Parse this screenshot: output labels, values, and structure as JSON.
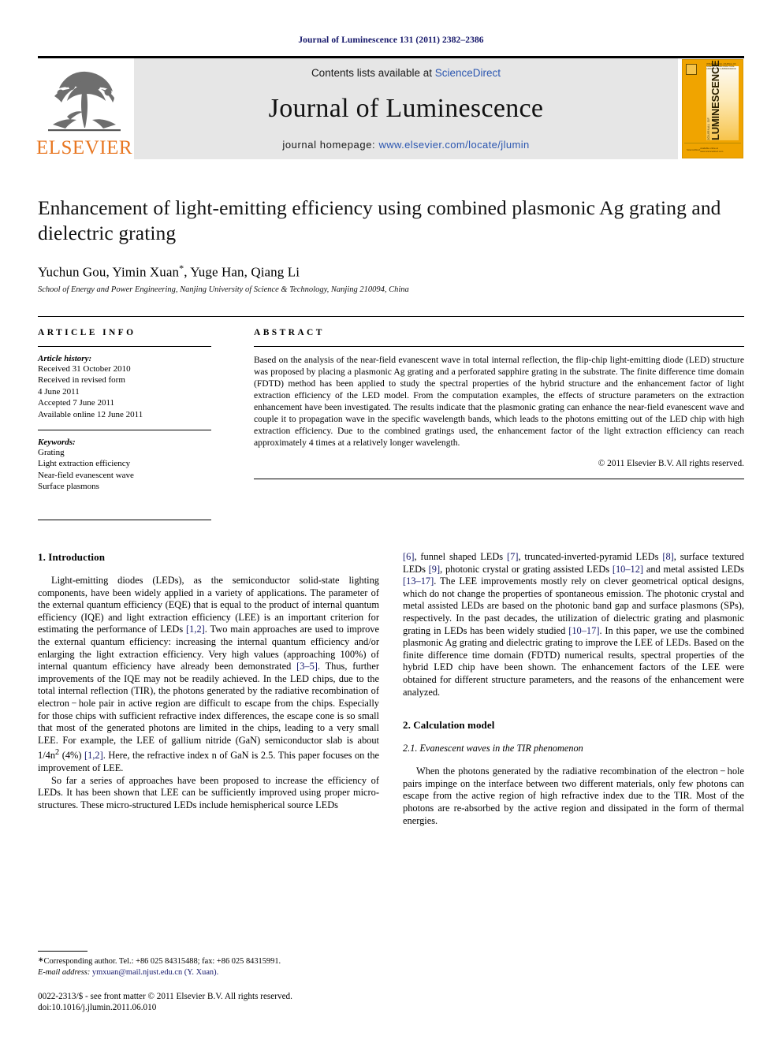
{
  "running_head": "Journal of Luminescence 131 (2011) 2382–2386",
  "masthead": {
    "publisher_wordmark": "ELSEVIER",
    "contents_prefix": "Contents lists available at ",
    "contents_link": "ScienceDirect",
    "journal_title": "Journal of Luminescence",
    "homepage_prefix": "journal homepage: ",
    "homepage_url": "www.elsevier.com/locate/jlumin",
    "cover": {
      "masthead_small": "INTERNATIONAL JOURNAL OF SCIENTIFIC AND PRACTICAL ASPECTS OF LUMINESCENCE",
      "journal_of": "JOURNAL OF",
      "title": "LUMINESCENCE",
      "footer_left": "ScienceDirect",
      "footer_right": "Available online at www.sciencedirect.com"
    },
    "link_color": "#2b56b0",
    "brand_color": "#e87722"
  },
  "article": {
    "title": "Enhancement of light-emitting efficiency using combined plasmonic Ag grating and dielectric grating",
    "authors": "Yuchun Gou, Yimin Xuan",
    "authors_tail": ", Yuge Han, Qiang Li",
    "corresponding_marker": "*",
    "affiliation": "School of Energy and Power Engineering, Nanjing University of Science & Technology, Nanjing 210094, China"
  },
  "article_info": {
    "label": "ARTICLE INFO",
    "history_head": "Article history:",
    "history": [
      "Received 31 October 2010",
      "Received in revised form",
      "4 June 2011",
      "Accepted 7 June 2011",
      "Available online 12 June 2011"
    ],
    "keywords_head": "Keywords:",
    "keywords": [
      "Grating",
      "Light extraction efficiency",
      "Near-field evanescent wave",
      "Surface plasmons"
    ]
  },
  "abstract": {
    "label": "ABSTRACT",
    "text": "Based on the analysis of the near-field evanescent wave in total internal reflection, the flip-chip light-emitting diode (LED) structure was proposed by placing a plasmonic Ag grating and a perforated sapphire grating in the substrate. The finite difference time domain (FDTD) method has been applied to study the spectral properties of the hybrid structure and the enhancement factor of light extraction efficiency of the LED model. From the computation examples, the effects of structure parameters on the extraction enhancement have been investigated. The results indicate that the plasmonic grating can enhance the near-field evanescent wave and couple it to propagation wave in the specific wavelength bands, which leads to the photons emitting out of the LED chip with high extraction efficiency. Due to the combined gratings used, the enhancement factor of the light extraction efficiency can reach approximately 4 times at a relatively longer wavelength.",
    "copyright": "© 2011 Elsevier B.V. All rights reserved."
  },
  "sections": {
    "intro_title": "1.  Introduction",
    "intro_p1_a": "Light-emitting diodes (LEDs), as the semiconductor solid-state lighting components, have been widely applied in a variety of applications. The parameter of the external quantum efficiency (EQE) that is equal to the product of internal quantum efficiency (IQE) and light extraction efficiency (LEE) is an important criterion for estimating the performance of LEDs ",
    "intro_ref_12a": "[1,2]",
    "intro_p1_b": ". Two main approaches are used to improve the external quantum efficiency: increasing the internal quantum efficiency and/or enlarging the light extraction efficiency. Very high values (approaching 100%) of internal quantum efficiency have already been demonstrated ",
    "intro_ref_35": "[3–5]",
    "intro_p1_c": ". Thus, further improvements of the IQE may not be readily achieved. In the LED chips, due to the total internal reflection (TIR), the photons generated by the radiative recombination of electron − hole pair in active region are difficult to escape from the chips. Especially for those chips with sufficient refractive index differences, the escape cone is so small that most of the generated photons are limited in the chips, leading to a very small LEE. For example, the LEE of gallium nitride (GaN) semiconductor slab is about 1/4n",
    "intro_p1_sup": "2",
    "intro_p1_d": " (4%) ",
    "intro_ref_12b": "[1,2]",
    "intro_p1_e": ". Here, the refractive index n of GaN is 2.5. This paper focuses on the improvement of LEE.",
    "intro_p2_a": "So far a series of approaches have been proposed to increase the efficiency of LEDs. It has been shown that LEE can be sufficiently improved using proper micro-structures. These micro-structured LEDs include hemispherical source LEDs ",
    "intro_ref_6": "[6]",
    "intro_p2_b": ", funnel shaped LEDs ",
    "intro_ref_7": "[7]",
    "intro_p2_c": ", truncated-inverted-pyramid LEDs ",
    "intro_ref_8": "[8]",
    "intro_p2_d": ", surface textured LEDs ",
    "intro_ref_9": "[9]",
    "intro_p2_e": ", photonic crystal or grating assisted LEDs ",
    "intro_ref_1012": "[10–12]",
    "intro_p2_f": " and metal assisted LEDs ",
    "intro_ref_1317": "[13–17]",
    "intro_p2_g": ". The LEE improvements mostly rely on clever geometrical optical designs, which do not change the properties of spontaneous emission. The photonic crystal and metal assisted LEDs are based on the photonic band gap and surface plasmons (SPs), respectively. In the past decades, the utilization of dielectric grating and plasmonic grating in LEDs has been widely studied ",
    "intro_ref_1017": "[10–17]",
    "intro_p2_h": ". In this paper, we use the combined plasmonic Ag grating and dielectric grating to improve the LEE of LEDs. Based on the finite difference time domain (FDTD) numerical results, spectral properties of the hybrid LED chip have been shown. The enhancement factors of the LEE were obtained for different structure parameters, and the reasons of the enhancement were analyzed.",
    "calc_title": "2.  Calculation model",
    "calc_subtitle": "2.1.  Evanescent waves in the TIR phenomenon",
    "calc_p1": "When the photons generated by the radiative recombination of the electron − hole pairs impinge on the interface between two different materials, only few photons can escape from the active region of high refractive index due to the TIR. Most of the photons are re-absorbed by the active region and dissipated in the form of thermal energies."
  },
  "footnotes": {
    "corresponding": "Corresponding author. Tel.: +86 025 84315488; fax: +86 025 84315991.",
    "email_label": "E-mail address:",
    "email": " ymxuan@mail.njust.edu.cn (Y. Xuan).",
    "issn_line": "0022-2313/$ - see front matter © 2011 Elsevier B.V. All rights reserved.",
    "doi_line": "doi:10.1016/j.jlumin.2011.06.010"
  }
}
